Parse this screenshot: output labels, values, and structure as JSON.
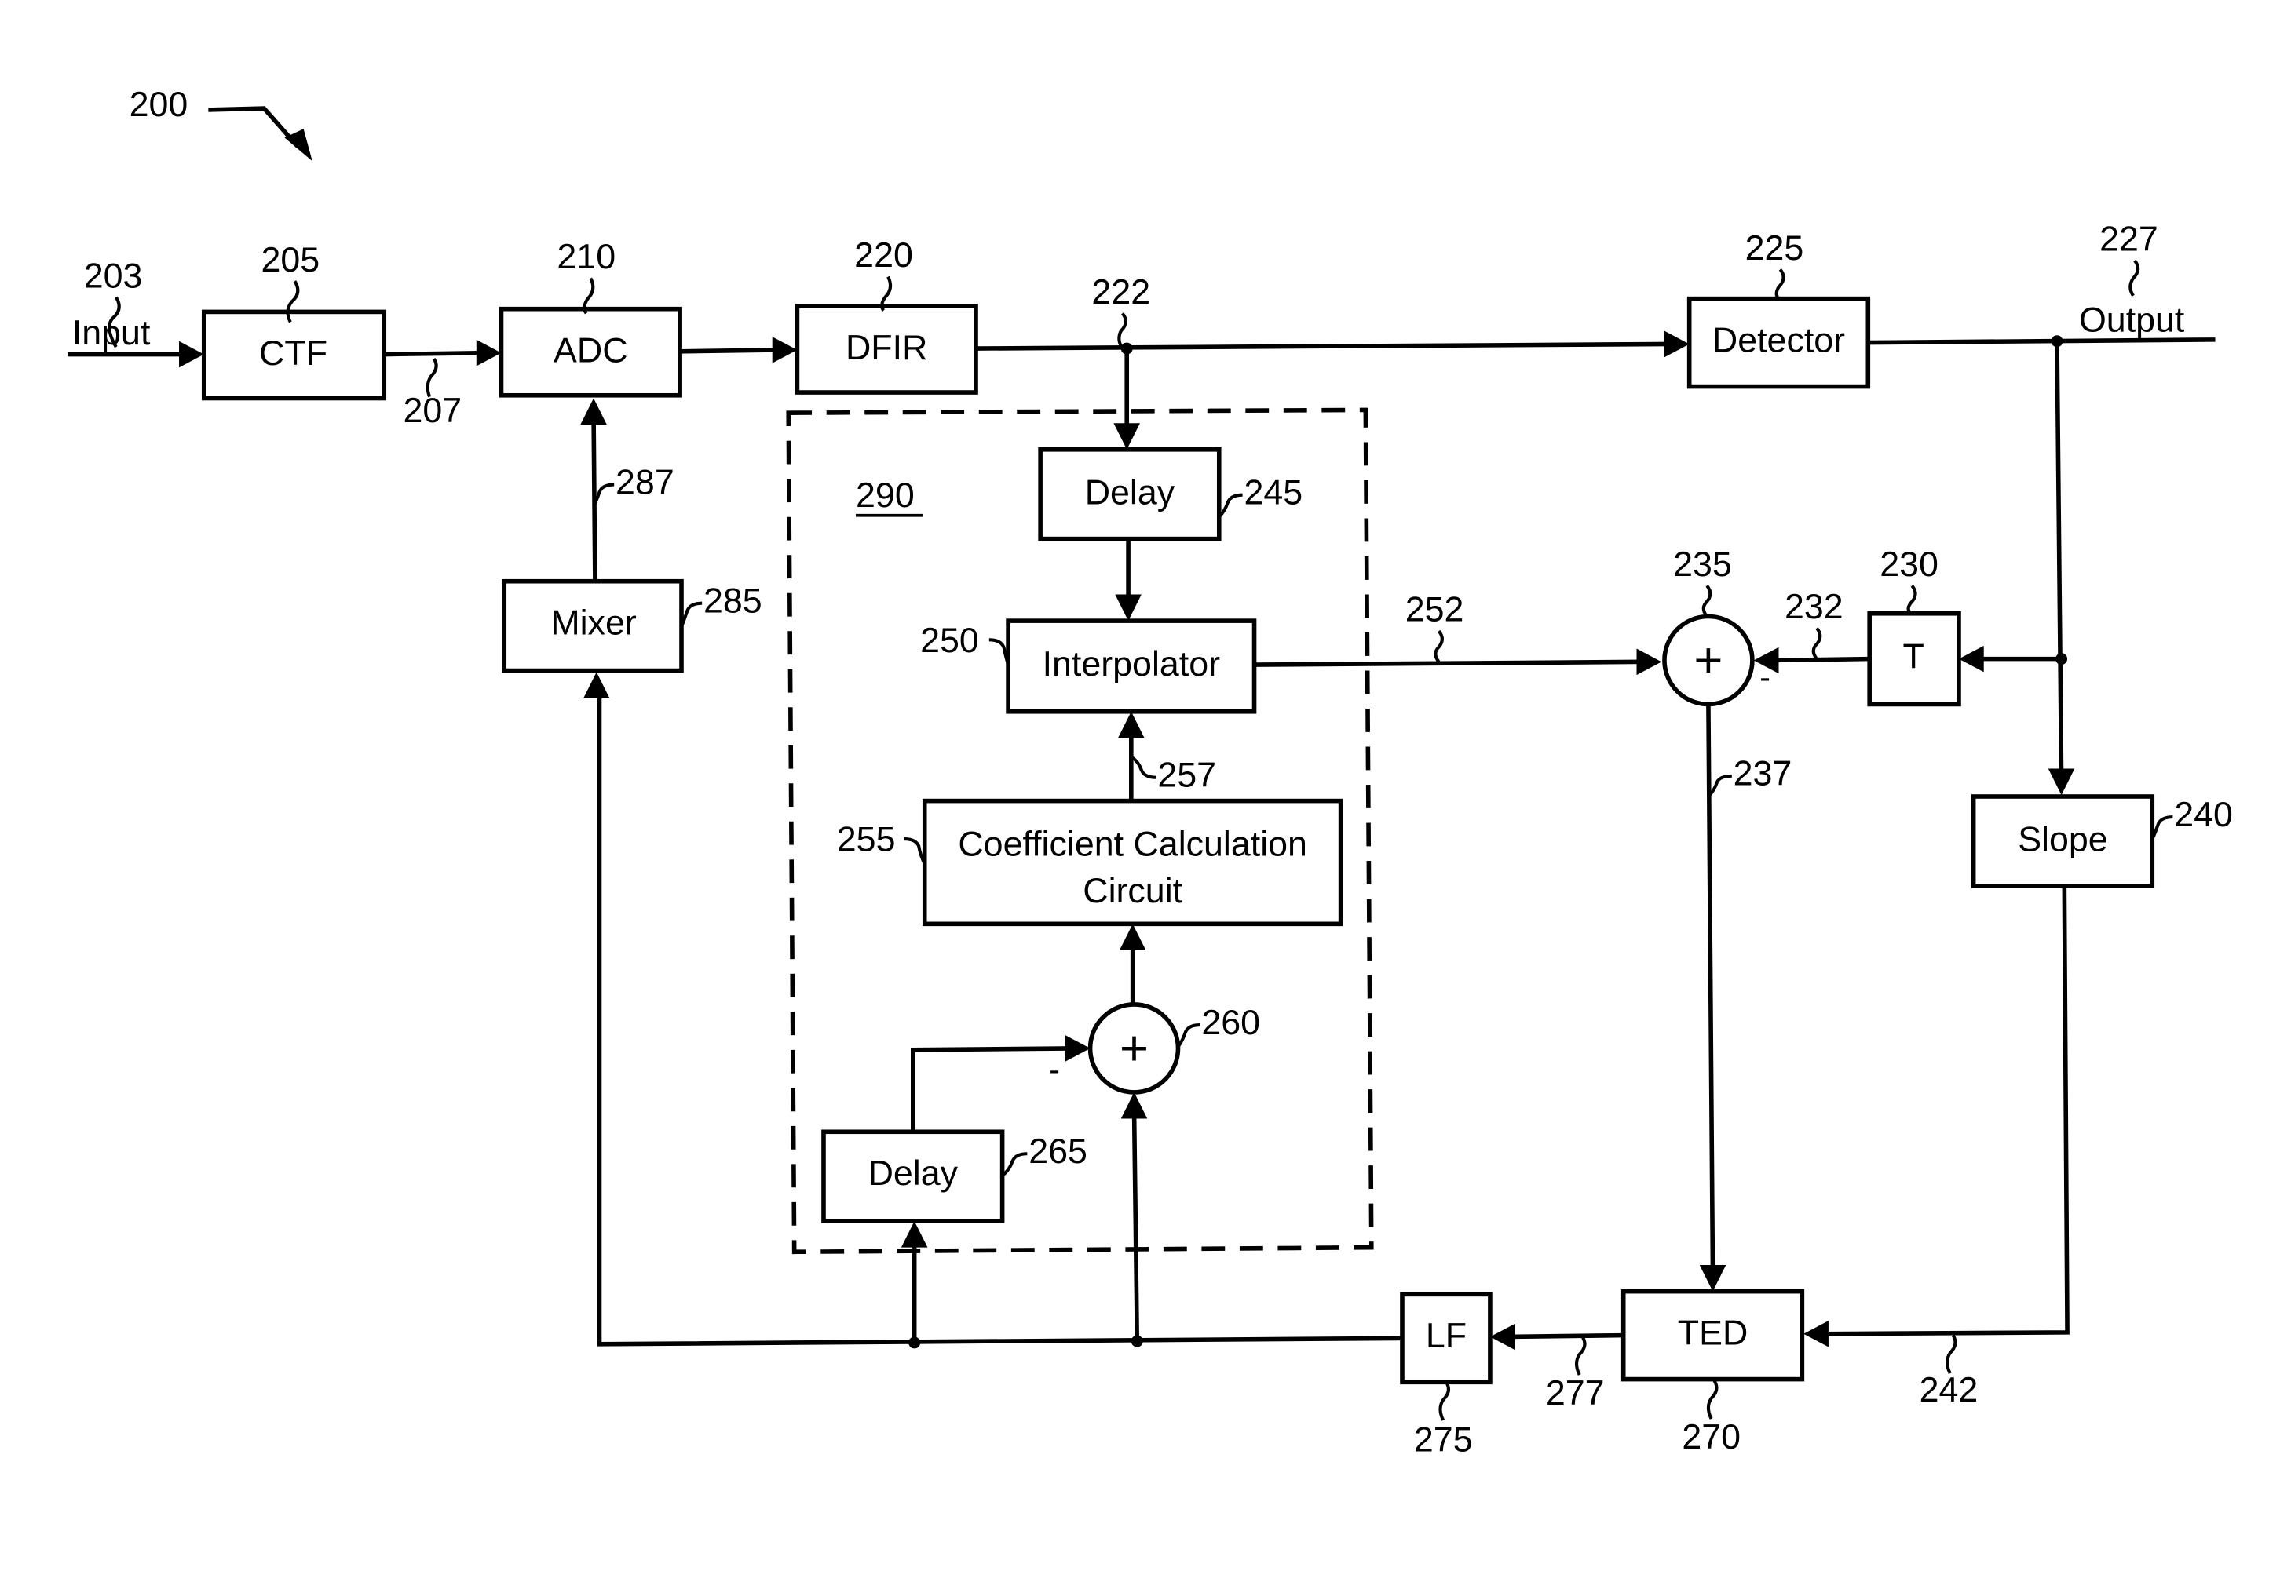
{
  "figure": {
    "ref": "200",
    "group": {
      "ref": "290"
    }
  },
  "signals": {
    "input": {
      "label": "Input",
      "ref": "203"
    },
    "output": {
      "label": "Output",
      "ref": "227"
    },
    "s207": "207",
    "s222": "222",
    "s232": "232",
    "s237": "237",
    "s242": "242",
    "s252": "252",
    "s257": "257",
    "s277": "277",
    "s287": "287"
  },
  "blocks": {
    "ctf": {
      "label": "CTF",
      "ref": "205"
    },
    "adc": {
      "label": "ADC",
      "ref": "210"
    },
    "dfir": {
      "label": "DFIR",
      "ref": "220"
    },
    "detector": {
      "label": "Detector",
      "ref": "225"
    },
    "t": {
      "label": "T",
      "ref": "230"
    },
    "sum235": {
      "label": "+",
      "ref": "235",
      "minus": "-"
    },
    "slope": {
      "label": "Slope",
      "ref": "240"
    },
    "delay245": {
      "label": "Delay",
      "ref": "245"
    },
    "interpolator": {
      "label": "Interpolator",
      "ref": "250"
    },
    "coeff": {
      "label_line1": "Coefficient Calculation",
      "label_line2": "Circuit",
      "ref": "255"
    },
    "sum260": {
      "label": "+",
      "ref": "260",
      "minus": "-"
    },
    "delay265": {
      "label": "Delay",
      "ref": "265"
    },
    "ted": {
      "label": "TED",
      "ref": "270"
    },
    "lf": {
      "label": "LF",
      "ref": "275"
    },
    "mixer": {
      "label": "Mixer",
      "ref": "285"
    }
  }
}
